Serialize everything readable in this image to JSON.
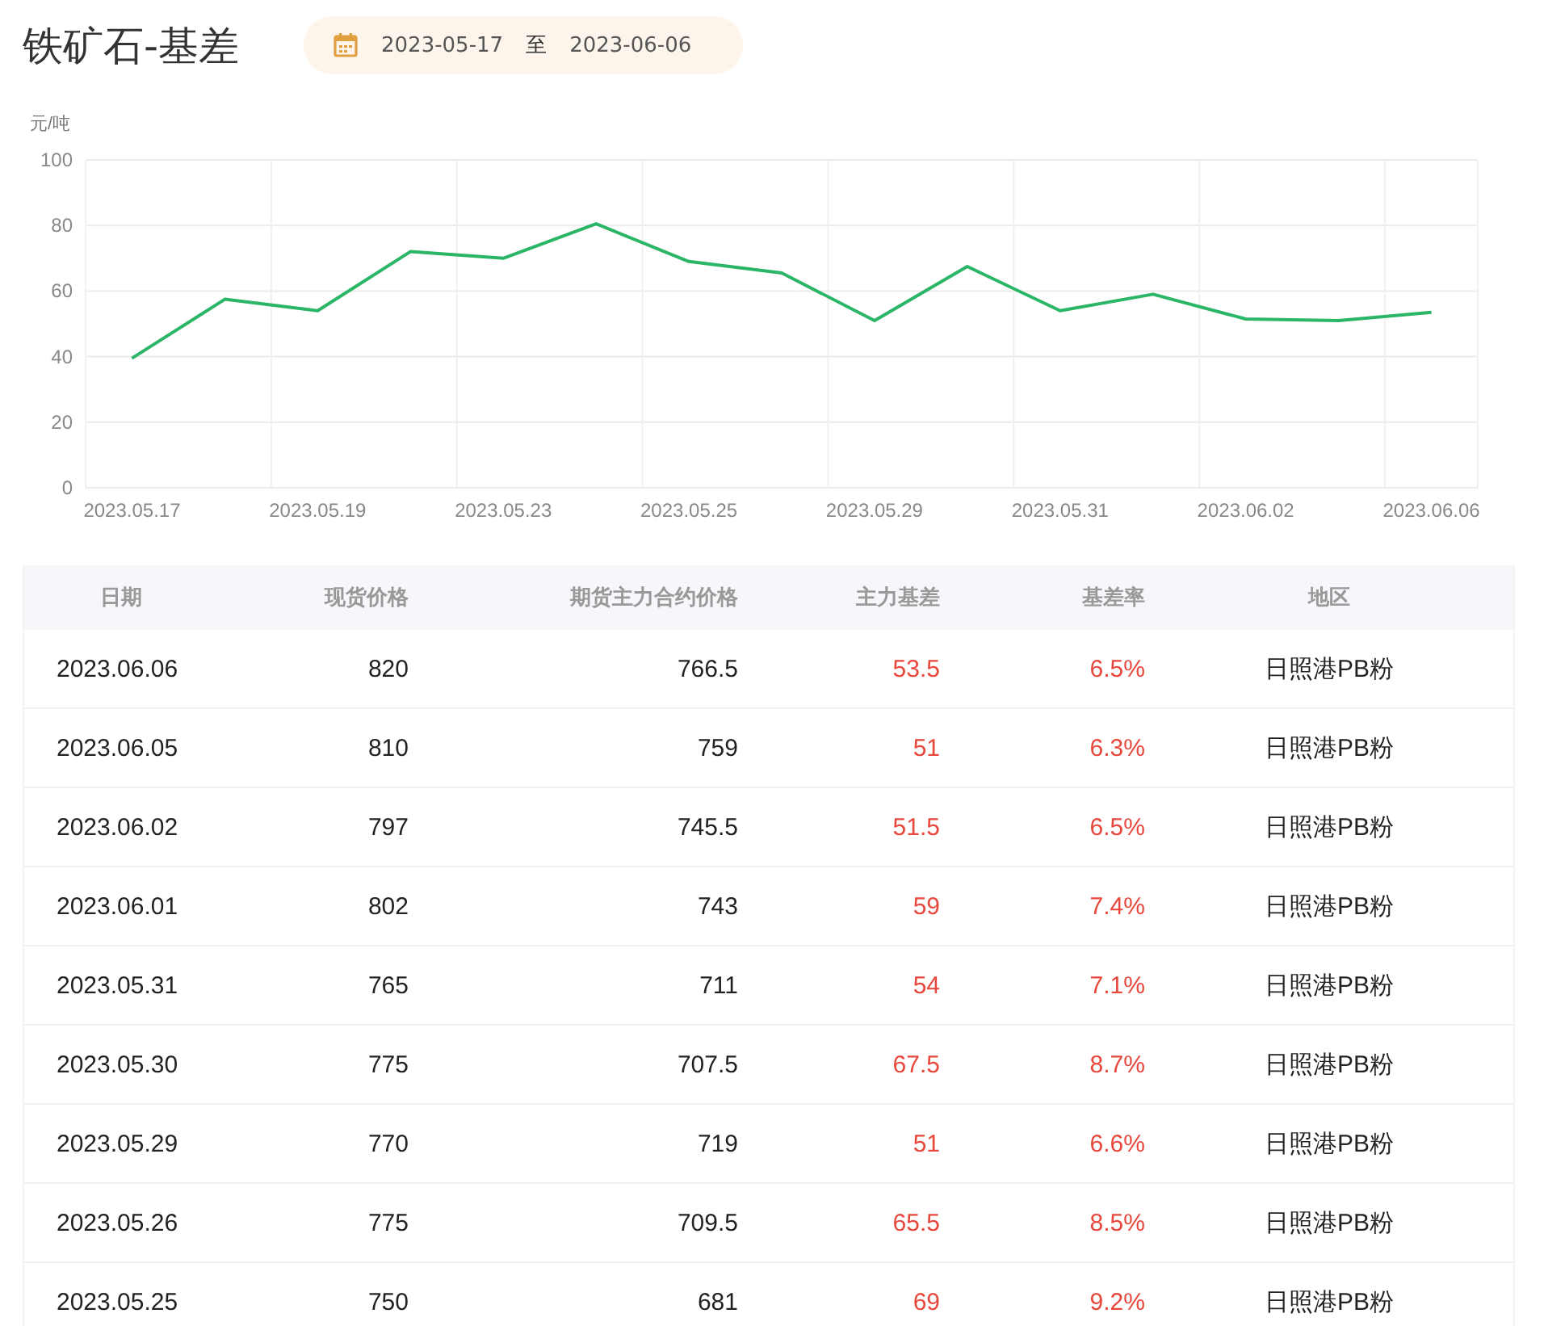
{
  "title": "铁矿石-基差",
  "date_range": {
    "start": "2023-05-17",
    "separator": "至",
    "end": "2023-06-06"
  },
  "chart": {
    "chart_data": {
      "type": "line",
      "ylabel": "元/吨",
      "grid": true,
      "categories": [
        "2023.05.17",
        null,
        "2023.05.19",
        null,
        "2023.05.23",
        null,
        "2023.05.25",
        null,
        "2023.05.29",
        null,
        "2023.05.31",
        null,
        "2023.06.02",
        null,
        "2023.06.06"
      ],
      "ylim": [
        0,
        100
      ],
      "yticks": [
        0,
        20,
        40,
        60,
        80,
        100
      ],
      "series": [
        {
          "color": "#2bb567",
          "values": [
            39.5,
            57.5,
            54,
            72,
            70,
            80.5,
            69,
            65.5,
            51,
            67.5,
            54,
            59,
            51.5,
            51,
            53.5
          ]
        }
      ]
    }
  },
  "table": {
    "columns": [
      "日期",
      "现货价格",
      "期货主力合约价格",
      "主力基差",
      "基差率",
      "地区"
    ],
    "rows": [
      [
        "2023.06.06",
        "820",
        "766.5",
        "53.5",
        "6.5%",
        "日照港PB粉"
      ],
      [
        "2023.06.05",
        "810",
        "759",
        "51",
        "6.3%",
        "日照港PB粉"
      ],
      [
        "2023.06.02",
        "797",
        "745.5",
        "51.5",
        "6.5%",
        "日照港PB粉"
      ],
      [
        "2023.06.01",
        "802",
        "743",
        "59",
        "7.4%",
        "日照港PB粉"
      ],
      [
        "2023.05.31",
        "765",
        "711",
        "54",
        "7.1%",
        "日照港PB粉"
      ],
      [
        "2023.05.30",
        "775",
        "707.5",
        "67.5",
        "8.7%",
        "日照港PB粉"
      ],
      [
        "2023.05.29",
        "770",
        "719",
        "51",
        "6.6%",
        "日照港PB粉"
      ],
      [
        "2023.05.26",
        "775",
        "709.5",
        "65.5",
        "8.5%",
        "日照港PB粉"
      ],
      [
        "2023.05.25",
        "750",
        "681",
        "69",
        "9.2%",
        "日照港PB粉"
      ]
    ]
  }
}
